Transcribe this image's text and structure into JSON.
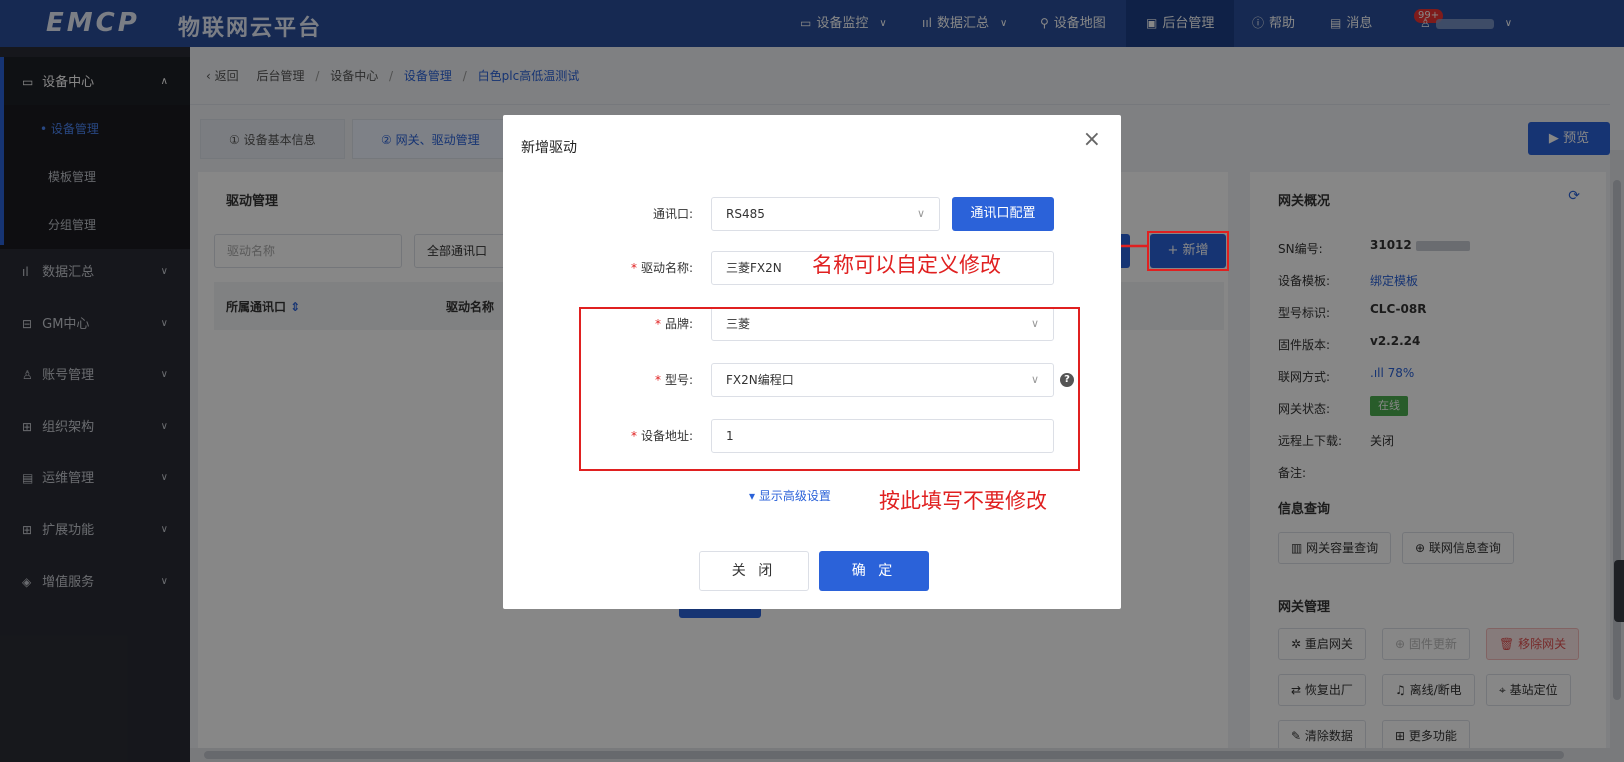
{
  "header": {
    "logo_text": "EMCP",
    "platform_name": "物联网云平台",
    "nav": [
      {
        "label": "设备监控",
        "icon": "monitor-icon"
      },
      {
        "label": "数据汇总",
        "icon": "bar-chart-icon"
      },
      {
        "label": "设备地图",
        "icon": "map-pin-icon"
      },
      {
        "label": "后台管理",
        "icon": "admin-icon"
      },
      {
        "label": "帮助",
        "icon": "help-icon"
      },
      {
        "label": "消息",
        "icon": "message-icon"
      }
    ],
    "message_badge": "99+"
  },
  "sidebar": {
    "items": [
      {
        "label": "设备中心",
        "icon": "device-icon"
      },
      {
        "label": "数据汇总",
        "icon": "bar-chart-icon"
      },
      {
        "label": "GM中心",
        "icon": "gm-icon"
      },
      {
        "label": "账号管理",
        "icon": "user-icon"
      },
      {
        "label": "组织架构",
        "icon": "org-icon"
      },
      {
        "label": "运维管理",
        "icon": "ops-icon"
      },
      {
        "label": "扩展功能",
        "icon": "grid-icon"
      },
      {
        "label": "增值服务",
        "icon": "layers-icon"
      }
    ],
    "subitems": [
      {
        "label": "设备管理"
      },
      {
        "label": "模板管理"
      },
      {
        "label": "分组管理"
      }
    ]
  },
  "breadcrumb": {
    "back": "返回",
    "items": [
      "后台管理",
      "设备中心",
      "设备管理",
      "白色plc高低温测试"
    ]
  },
  "tabs": [
    {
      "label": "① 设备基本信息"
    },
    {
      "label": "② 网关、驱动管理"
    }
  ],
  "preview_button": "预览",
  "driver_panel": {
    "title": "驱动管理",
    "search_placeholder": "驱动名称",
    "port_filter": "全部通讯口",
    "columns": [
      "所属通讯口",
      "驱动名称"
    ],
    "add_button": "新增"
  },
  "gateway": {
    "title": "网关概况",
    "rows": [
      {
        "label": "SN编号:",
        "value": "31012"
      },
      {
        "label": "设备模板:",
        "value": "绑定模板"
      },
      {
        "label": "型号标识:",
        "value": "CLC-08R"
      },
      {
        "label": "固件版本:",
        "value": "v2.2.24"
      },
      {
        "label": "联网方式:",
        "value": "78%"
      },
      {
        "label": "网关状态:",
        "value": "在线"
      },
      {
        "label": "远程上下载:",
        "value": "关闭"
      },
      {
        "label": "备注:",
        "value": ""
      }
    ],
    "info_query_title": "信息查询",
    "info_buttons": [
      "网关容量查询",
      "联网信息查询"
    ],
    "manage_title": "网关管理",
    "manage_buttons": [
      "重启网关",
      "固件更新",
      "移除网关",
      "恢复出厂",
      "离线/断电",
      "基站定位",
      "清除数据",
      "更多功能"
    ]
  },
  "dialog": {
    "title": "新增驱动",
    "port_label": "通讯口:",
    "port_value": "RS485",
    "port_config_button": "通讯口配置",
    "name_label": "驱动名称:",
    "name_value": "三菱FX2N",
    "brand_label": "品牌:",
    "brand_value": "三菱",
    "model_label": "型号:",
    "model_value": "FX2N编程口",
    "address_label": "设备地址:",
    "address_value": "1",
    "advanced_link": "显示高级设置",
    "close_button": "关 闭",
    "confirm_button": "确 定"
  },
  "annotations": {
    "name_note": "名称可以自定义修改",
    "fill_note": "按此填写不要修改",
    "color": "#e02020"
  },
  "colors": {
    "primary": "#2b62d9",
    "header": "#2b4f9b",
    "sidebar": "#2b2d35",
    "online": "#4caf50"
  }
}
